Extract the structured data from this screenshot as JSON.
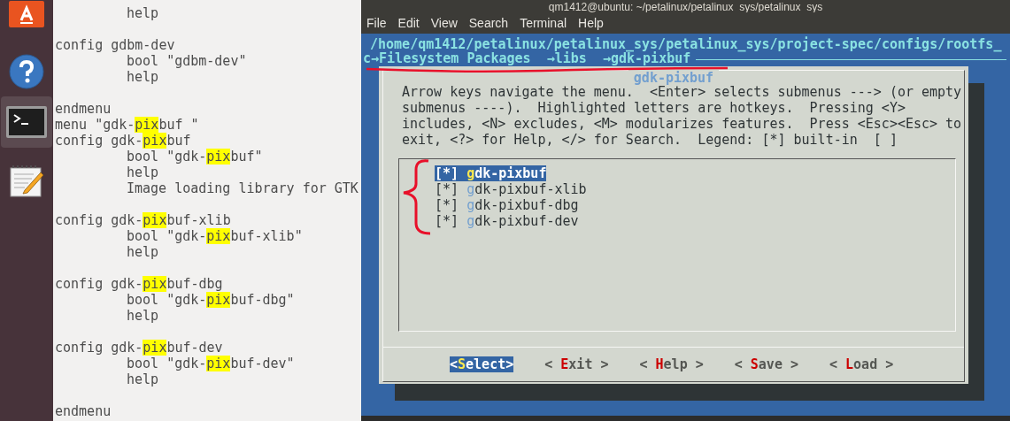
{
  "launcher": {
    "items": [
      {
        "kind": "software",
        "selected": false
      },
      {
        "kind": "help",
        "selected": false
      },
      {
        "kind": "terminal",
        "selected": true
      },
      {
        "kind": "editor",
        "selected": false
      }
    ]
  },
  "editor": {
    "lines": [
      {
        "kind": "code",
        "indented": true,
        "parts": [
          {
            "text": "help",
            "highlight": false
          }
        ]
      },
      {
        "kind": "blank"
      },
      {
        "kind": "code",
        "indented": false,
        "parts": [
          {
            "text": "config gdbm-dev",
            "highlight": false
          }
        ]
      },
      {
        "kind": "code",
        "indented": true,
        "parts": [
          {
            "text": "bool \"gdbm-dev\"",
            "highlight": false
          }
        ]
      },
      {
        "kind": "code",
        "indented": true,
        "parts": [
          {
            "text": "help",
            "highlight": false
          }
        ]
      },
      {
        "kind": "blank"
      },
      {
        "kind": "code",
        "indented": false,
        "parts": [
          {
            "text": "endmenu",
            "highlight": false
          }
        ]
      },
      {
        "kind": "code",
        "indented": false,
        "parts": [
          {
            "text": "menu \"gdk-",
            "highlight": false
          },
          {
            "text": "pix",
            "highlight": true
          },
          {
            "text": "buf \"",
            "highlight": false
          }
        ]
      },
      {
        "kind": "code",
        "indented": false,
        "parts": [
          {
            "text": "config gdk-",
            "highlight": false
          },
          {
            "text": "pix",
            "highlight": true
          },
          {
            "text": "buf",
            "highlight": false
          }
        ]
      },
      {
        "kind": "code",
        "indented": true,
        "parts": [
          {
            "text": "bool \"gdk-",
            "highlight": false
          },
          {
            "text": "pix",
            "highlight": true
          },
          {
            "text": "buf\"",
            "highlight": false
          }
        ]
      },
      {
        "kind": "code",
        "indented": true,
        "parts": [
          {
            "text": "help",
            "highlight": false
          }
        ]
      },
      {
        "kind": "code",
        "indented": true,
        "parts": [
          {
            "text": "Image loading library for GTK",
            "highlight": false
          }
        ]
      },
      {
        "kind": "blank"
      },
      {
        "kind": "code",
        "indented": false,
        "parts": [
          {
            "text": "config gdk-",
            "highlight": false
          },
          {
            "text": "pix",
            "highlight": true
          },
          {
            "text": "buf-xlib",
            "highlight": false
          }
        ]
      },
      {
        "kind": "code",
        "indented": true,
        "parts": [
          {
            "text": "bool \"gdk-",
            "highlight": false
          },
          {
            "text": "pix",
            "highlight": true
          },
          {
            "text": "buf-xlib\"",
            "highlight": false
          }
        ]
      },
      {
        "kind": "code",
        "indented": true,
        "parts": [
          {
            "text": "help",
            "highlight": false
          }
        ]
      },
      {
        "kind": "blank"
      },
      {
        "kind": "code",
        "indented": false,
        "parts": [
          {
            "text": "config gdk-",
            "highlight": false
          },
          {
            "text": "pix",
            "highlight": true
          },
          {
            "text": "buf-dbg",
            "highlight": false
          }
        ]
      },
      {
        "kind": "code",
        "indented": true,
        "parts": [
          {
            "text": "bool \"gdk-",
            "highlight": false
          },
          {
            "text": "pix",
            "highlight": true
          },
          {
            "text": "buf-dbg\"",
            "highlight": false
          }
        ]
      },
      {
        "kind": "code",
        "indented": true,
        "parts": [
          {
            "text": "help",
            "highlight": false
          }
        ]
      },
      {
        "kind": "blank"
      },
      {
        "kind": "code",
        "indented": false,
        "parts": [
          {
            "text": "config gdk-",
            "highlight": false
          },
          {
            "text": "pix",
            "highlight": true
          },
          {
            "text": "buf-dev",
            "highlight": false
          }
        ]
      },
      {
        "kind": "code",
        "indented": true,
        "parts": [
          {
            "text": "bool \"gdk-",
            "highlight": false
          },
          {
            "text": "pix",
            "highlight": true
          },
          {
            "text": "buf-dev\"",
            "highlight": false
          }
        ]
      },
      {
        "kind": "code",
        "indented": true,
        "parts": [
          {
            "text": "help",
            "highlight": false
          }
        ]
      },
      {
        "kind": "blank"
      },
      {
        "kind": "code",
        "indented": false,
        "parts": [
          {
            "text": "endmenu",
            "highlight": false
          }
        ]
      }
    ]
  },
  "terminal": {
    "title": "qm1412@ubuntu: ~/petalinux/petalinux_sys/petalinux_sys",
    "menu": [
      "File",
      "Edit",
      "View",
      "Search",
      "Terminal",
      "Help"
    ],
    "path": "/home/qm1412/petalinux/petalinux_sys/petalinux_sys/project-spec/configs/rootfs_",
    "breadcrumb": "c→Filesystem Packages  →libs  →gdk-pixbuf",
    "dialog": {
      "title": "gdk-pixbuf",
      "help_text": "Arrow keys navigate the menu.  <Enter> selects submenus ---> (or empty\nsubmenus ----).  Highlighted letters are hotkeys.  Pressing <Y>\nincludes, <N> excludes, <M> modularizes features.  Press <Esc><Esc> to\nexit, <?> for Help, </> for Search.  Legend: [*] built-in  [ ]",
      "items": [
        {
          "checkbox": "[*]",
          "hotkey": "g",
          "label": "dk-pixbuf",
          "selected": true
        },
        {
          "checkbox": "[*]",
          "hotkey": "g",
          "label": "dk-pixbuf-xlib",
          "selected": false
        },
        {
          "checkbox": "[*]",
          "hotkey": "g",
          "label": "dk-pixbuf-dbg",
          "selected": false
        },
        {
          "checkbox": "[*]",
          "hotkey": "g",
          "label": "dk-pixbuf-dev",
          "selected": false
        }
      ],
      "buttons": [
        {
          "before": "<",
          "hotkey": "S",
          "after": "elect>",
          "selected": true
        },
        {
          "before": "< ",
          "hotkey": "E",
          "after": "xit >",
          "selected": false
        },
        {
          "before": "< ",
          "hotkey": "H",
          "after": "elp >",
          "selected": false
        },
        {
          "before": "< ",
          "hotkey": "S",
          "after": "ave >",
          "selected": false
        },
        {
          "before": "< ",
          "hotkey": "L",
          "after": "oad >",
          "selected": false
        }
      ]
    }
  }
}
